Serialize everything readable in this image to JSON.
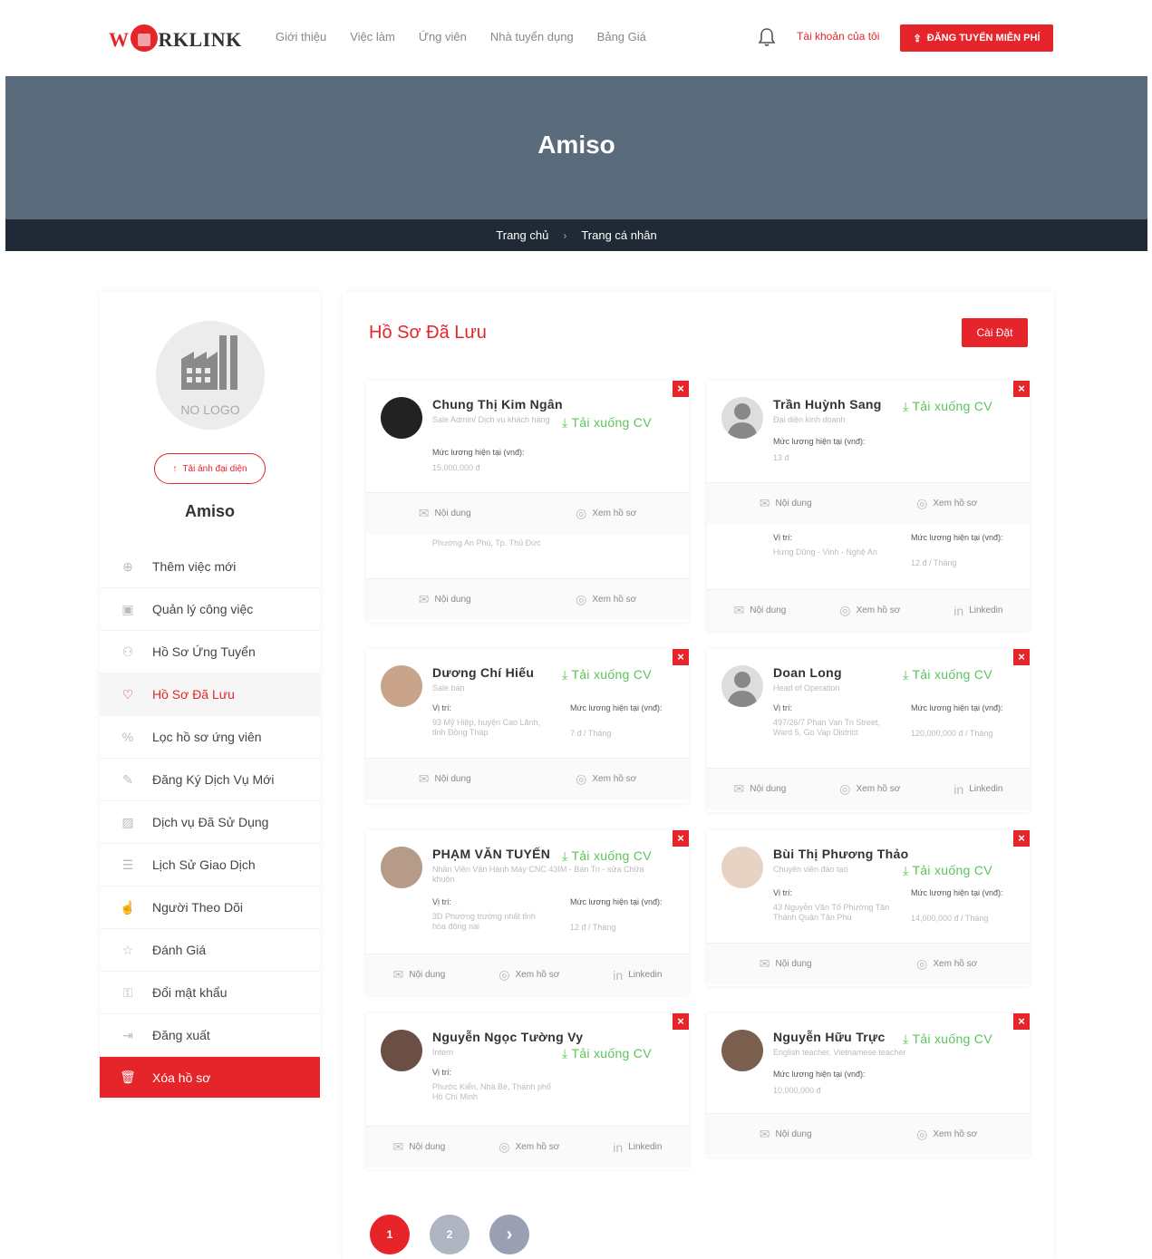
{
  "header": {
    "logo": {
      "pre": "W",
      "post": "RKLINK"
    },
    "nav": [
      "Giới thiệu",
      "Việc làm",
      "Ứng viên",
      "Nhà tuyển dụng",
      "Bảng Giá"
    ],
    "account": "Tài khoản của tôi",
    "post_button": "ĐĂNG TUYỂN MIỄN PHÍ"
  },
  "banner": {
    "title": "Amiso",
    "breadcrumb": [
      "Trang chủ",
      "Trang cá nhân"
    ]
  },
  "sidebar": {
    "logo_placeholder": "NO LOGO",
    "avatar_button": "Tải ảnh đại diện",
    "company_name": "Amiso",
    "menu": [
      {
        "label": "Thêm việc mới",
        "icon": "plus-circle-icon"
      },
      {
        "label": "Quản lý công việc",
        "icon": "briefcase-icon"
      },
      {
        "label": "Hồ Sơ Ứng Tuyển",
        "icon": "users-icon"
      },
      {
        "label": "Hồ Sơ Đã Lưu",
        "icon": "heart-icon",
        "active": true
      },
      {
        "label": "Lọc hồ sơ ứng viên",
        "icon": "filter-icon"
      },
      {
        "label": "Đăng Ký Dịch Vụ Mới",
        "icon": "pen-icon"
      },
      {
        "label": "Dịch vụ Đã Sử Dụng",
        "icon": "image-icon"
      },
      {
        "label": "Lịch Sử Giao Dịch",
        "icon": "history-icon"
      },
      {
        "label": "Người Theo Dõi",
        "icon": "thumbs-up-icon"
      },
      {
        "label": "Đánh Giá",
        "icon": "star-icon"
      },
      {
        "label": "Đổi mật khẩu",
        "icon": "user-lock-icon"
      },
      {
        "label": "Đăng xuất",
        "icon": "logout-icon"
      },
      {
        "label": "Xóa hồ sơ",
        "icon": "trash-icon",
        "danger": true
      }
    ]
  },
  "main": {
    "title": "Hồ Sơ Đã Lưu",
    "settings_button": "Cài Đặt",
    "download_label": "Tải xuống CV",
    "action_labels": {
      "content": "Nội dung",
      "view": "Xem hồ sơ",
      "linkedin": "Linkedin"
    },
    "candidates": [
      {
        "name": "Chung Thị Kim Ngân",
        "title": "Sale Admin/ Dịch vụ khách hàng",
        "salary_label": "Mức lương hiện tại (vnđ):",
        "salary": "15,000,000 đ",
        "extra_address": "Phường An Phú, Tp. Thủ Đức"
      },
      {
        "name": "Trần Huỳnh Sang",
        "title": "Đại diện kinh doanh",
        "salary_label": "Mức lương hiện tại (vnđ):",
        "salary": "13 đ",
        "pos_label": "Vị trí:",
        "address": "Hưng Dũng - Vinh - Nghệ An",
        "salary2_label": "Mức lương hiện tại (vnđ):",
        "salary2": "12 đ / Tháng"
      },
      {
        "name": "Dương Chí Hiếu",
        "title": "Sale bán",
        "pos_label": "Vị trí:",
        "address": "93 Mỹ Hiệp, huyện Cao Lãnh, tỉnh Đồng Tháp",
        "salary_label": "Mức lương hiện tại (vnđ):",
        "salary": "7 đ / Tháng"
      },
      {
        "name": "Doan Long",
        "title": "Head of Operation",
        "pos_label": "Vị trí:",
        "address": "497/26/7 Phan Van Tri Street, Ward 5, Go Vap District",
        "salary_label": "Mức lương hiện tại (vnđ):",
        "salary": "120,000,000 đ / Tháng"
      },
      {
        "name": "PHẠM VĂN TUYẾN",
        "title": "Nhân Viên Vận Hành Máy CNC 43IM - Bán Tri - sửa Chữa khuôn",
        "pos_label": "Vị trí:",
        "address": "3D Phường trường nhất tỉnh hòa đông nai",
        "salary_label": "Mức lương hiện tại (vnđ):",
        "salary": "12 đ / Tháng"
      },
      {
        "name": "Bùi Thị Phương Thảo",
        "title": "Chuyên viên đào tạo",
        "pos_label": "Vị trí:",
        "address": "43 Nguyễn Văn Tố Phường Tân Thành Quận Tân Phú",
        "salary_label": "Mức lương hiện tại (vnđ):",
        "salary": "14,000,000 đ / Tháng"
      },
      {
        "name": "Nguyễn Ngọc Tường Vy",
        "title": "Intern",
        "pos_label": "Vị trí:",
        "address": "Phước Kiển, Nhà Bè, Thành phố Hồ Chí Minh"
      },
      {
        "name": "Nguyễn Hữu Trực",
        "title": "English teacher, Vietnamese teacher",
        "salary_label": "Mức lương hiện tại (vnđ):",
        "salary": "10,000,000 đ"
      }
    ],
    "pagination": [
      "1",
      "2",
      "›"
    ]
  }
}
